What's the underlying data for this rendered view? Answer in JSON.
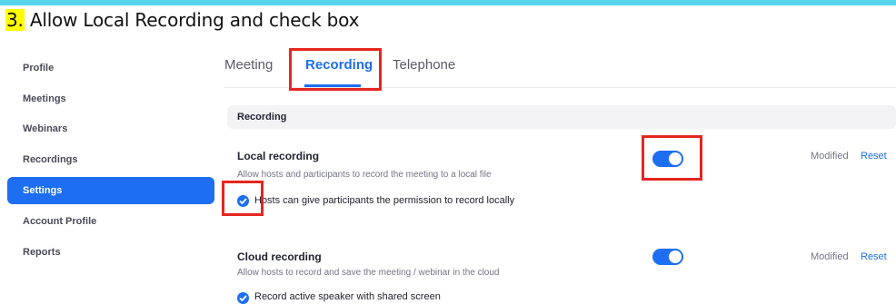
{
  "step": {
    "number": "3.",
    "text": "Allow Local Recording and check box"
  },
  "sidebar": {
    "items": [
      {
        "label": "Profile",
        "active": false
      },
      {
        "label": "Meetings",
        "active": false
      },
      {
        "label": "Webinars",
        "active": false
      },
      {
        "label": "Recordings",
        "active": false
      },
      {
        "label": "Settings",
        "active": true
      },
      {
        "label": "Account Profile",
        "active": false
      },
      {
        "label": "Reports",
        "active": false
      }
    ]
  },
  "tabs": [
    {
      "label": "Meeting",
      "active": false
    },
    {
      "label": "Recording",
      "active": true
    },
    {
      "label": "Telephone",
      "active": false
    }
  ],
  "section": {
    "title": "Recording"
  },
  "settings": {
    "local": {
      "title": "Local recording",
      "description": "Allow hosts and participants to record the meeting to a local file",
      "enabled": true,
      "modified": "Modified",
      "reset": "Reset",
      "option": {
        "label": "Hosts can give participants the permission to record locally",
        "checked": true
      }
    },
    "cloud": {
      "title": "Cloud recording",
      "description": "Allow hosts to record and save the meeting / webinar in the cloud",
      "enabled": true,
      "modified": "Modified",
      "reset": "Reset",
      "option": {
        "label": "Record active speaker with shared screen",
        "checked": true
      }
    }
  },
  "colors": {
    "accent": "#1d6ef2",
    "highlight": "#e5261f",
    "step_marker": "#ffff00",
    "top_bar": "#55d3ef"
  }
}
